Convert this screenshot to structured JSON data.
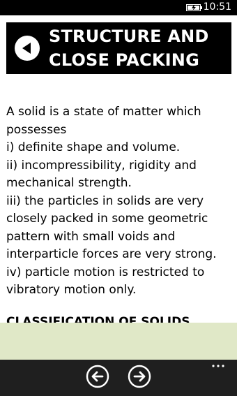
{
  "status_bar": {
    "time": "10:51",
    "battery_icon": "battery-charging-icon"
  },
  "header": {
    "title_line_1": "STRUCTURE AND",
    "title_line_2": "CLOSE PACKING",
    "back_icon": "back-arrow-icon"
  },
  "content": {
    "lines": [
      "A solid is a state of matter which",
      "possesses",
      "i) definite shape and volume.",
      "ii) incompressibility, rigidity and",
      "mechanical strength.",
      "iii) the particles in solids are very",
      "closely packed in some geometric",
      "pattern with small voids and",
      "interparticle forces are very strong.",
      "iv) particle motion is restricted to",
      "vibratory motion only."
    ],
    "section_heading": "CLASSIFICATION OF SOLIDS"
  },
  "app_bar": {
    "prev_icon": "arrow-left-circle-icon",
    "next_icon": "arrow-right-circle-icon",
    "more_icon": "ellipsis-icon"
  },
  "colors": {
    "header_bg": "#000000",
    "ad_band": "#e0e8c7",
    "app_bar_bg": "#1f1f1f"
  }
}
